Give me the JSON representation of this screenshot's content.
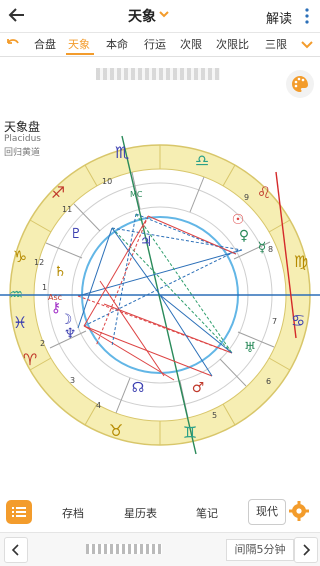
{
  "header": {
    "title": "天象",
    "explain_label": "解读"
  },
  "tabs": [
    {
      "label": "合盘"
    },
    {
      "label": "天象"
    },
    {
      "label": "本命"
    },
    {
      "label": "行运"
    },
    {
      "label": "次限"
    },
    {
      "label": "次限比"
    },
    {
      "label": "三限"
    }
  ],
  "active_tab": "天象",
  "chart_info": {
    "title": "天象盘",
    "house_system": "Placidus",
    "zodiac": "回归黄道"
  },
  "wheel": {
    "house_numbers": [
      "1",
      "2",
      "3",
      "4",
      "5",
      "6",
      "7",
      "8",
      "9",
      "10",
      "11",
      "12"
    ],
    "markers": {
      "mc": "MC",
      "asc": "Asc"
    }
  },
  "bottom_bar": {
    "archive_label": "存档",
    "ephemeris_label": "星历表",
    "notes_label": "笔记",
    "now_label": "现代"
  },
  "footer": {
    "interval_label": "间隔5分钟"
  },
  "colors": {
    "accent": "#f39c2c",
    "sign_ring": "#f6eeb3",
    "fire": "#c0392b",
    "earth": "#b58a00",
    "air": "#2ca088",
    "water": "#3b3fb0",
    "aspect_red": "#d44",
    "aspect_blue": "#2b6fb8",
    "aspect_green": "#2f9e6d"
  }
}
